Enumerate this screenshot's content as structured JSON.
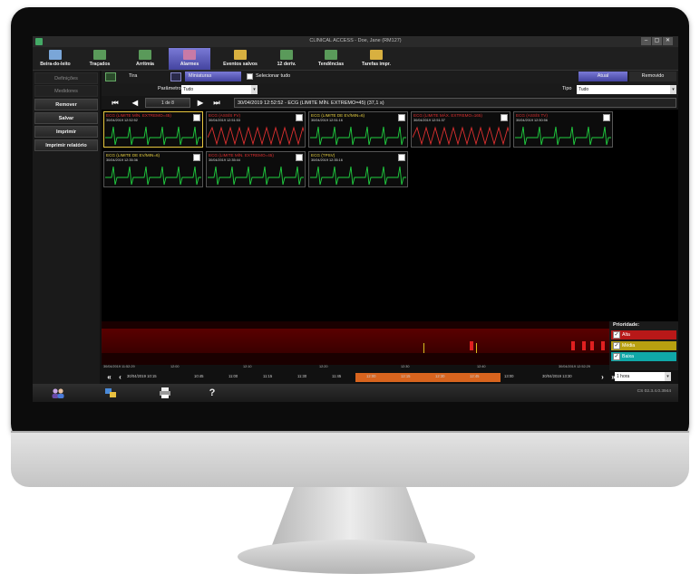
{
  "window": {
    "title": "CLINICAL ACCESS - Doe, Jane (RM127)",
    "controls": [
      "–",
      "▢",
      "✕"
    ]
  },
  "toolbar": {
    "items": [
      {
        "label": "Beira-do-leito",
        "icon": "bed-monitor-icon",
        "color": "#7aa6d8"
      },
      {
        "label": "Traçados",
        "icon": "waveform-icon",
        "color": "#5a9a5a"
      },
      {
        "label": "Arritmia",
        "icon": "arrhythmia-icon",
        "color": "#5a9a5a"
      },
      {
        "label": "Alarmes",
        "icon": "alarm-icon",
        "color": "#c87aa6"
      },
      {
        "label": "Eventos salvos",
        "icon": "folder-icon",
        "color": "#d8b040"
      },
      {
        "label": "12 deriv.",
        "icon": "leads-grid-icon",
        "color": "#5a9a5a"
      },
      {
        "label": "Tendências",
        "icon": "trends-icon",
        "color": "#5a9a5a"
      },
      {
        "label": "Tarefas impr.",
        "icon": "print-tasks-icon",
        "color": "#d8b040"
      }
    ],
    "active_index": 3
  },
  "sidebar": {
    "items": [
      {
        "label": "Definições",
        "enabled": false
      },
      {
        "label": "Medidores",
        "enabled": false
      },
      {
        "label": "Remover",
        "enabled": true
      },
      {
        "label": "Salvar",
        "enabled": true
      },
      {
        "label": "Imprimir",
        "enabled": true
      },
      {
        "label": "Imprimir relatório",
        "enabled": true
      }
    ]
  },
  "view_options": {
    "tira": "Tira",
    "miniaturas": "Miniaturas",
    "selecionar_tudo": "Selecionar tudo",
    "atual": "Atual",
    "removido": "Removido"
  },
  "filters": {
    "parametro_label": "Parâmetro",
    "parametro_value": "Tudo",
    "tipo_label": "Tipo",
    "tipo_value": "Tudo"
  },
  "pager": {
    "text": "1 de 8",
    "summary": "30/04/2019 12:52:52 - ECG (LIMITE MÍN. EXTREMO=45) (37,1 s)"
  },
  "thumbnails": [
    {
      "title": "ECG (LIMITE MÍN. EXTREMO=45)",
      "date": "30/04/2019 12:52:52",
      "color": "#e03030",
      "selected": true,
      "trace": "#20d040"
    },
    {
      "title": "ECG (ASSÍS FV)",
      "date": "30/04/2019 12:51:53",
      "color": "#e03030",
      "selected": false,
      "trace": "#e03030"
    },
    {
      "title": "ECG (LIMITE DE EV/MIN=6)",
      "date": "30/04/2019 12:51:16",
      "color": "#e8d040",
      "selected": false,
      "trace": "#20d040"
    },
    {
      "title": "ECG (LIMITE MÁX. EXTREMO=165)",
      "date": "30/04/2019 12:51:37",
      "color": "#e03030",
      "selected": false,
      "trace": "#e03030"
    },
    {
      "title": "ECG (ASSÍS TV)",
      "date": "30/04/2019 12:50:56",
      "color": "#e03030",
      "selected": false,
      "trace": "#20d040"
    },
    {
      "title": "ECG (LIMITE DE EV/MIN=6)",
      "date": "30/04/2019 12:35:36",
      "color": "#e8d040",
      "selected": false,
      "trace": "#20d040"
    },
    {
      "title": "ECG (LIMITE MÍN. EXTREMO=45)",
      "date": "30/04/2019 12:35:44",
      "color": "#e03030",
      "selected": false,
      "trace": "#20d040"
    },
    {
      "title": "ECG (TPSV)",
      "date": "30/04/2019 12:35:16",
      "color": "#e8d040",
      "selected": false,
      "trace": "#20d040"
    }
  ],
  "timeline": {
    "top_labels": [
      "30/04/2019 11:52:29",
      "12:00",
      "12:10",
      "12:20",
      "12:30",
      "12:40",
      "30/04/2019 12:52:29"
    ],
    "start_label": "30/04/2019 10:15",
    "ticks": [
      "10:45",
      "11:00",
      "11:15",
      "11:30",
      "11:45",
      "12:00",
      "12:15",
      "12:30",
      "12:45",
      "13:00"
    ],
    "end_label": "30/04/2019 13:30",
    "range_value": "1 hora",
    "events": [
      {
        "minute": 43.5,
        "level": "high"
      },
      {
        "minute": 44.2,
        "level": "medium"
      },
      {
        "minute": 55.5,
        "level": "high"
      },
      {
        "minute": 56.8,
        "level": "high"
      },
      {
        "minute": 57.8,
        "level": "high"
      },
      {
        "minute": 59.0,
        "level": "high"
      },
      {
        "minute": 38.0,
        "level": "medium"
      }
    ]
  },
  "priority": {
    "title": "Prioridade:",
    "items": [
      {
        "label": "Alta",
        "color": "#b81818"
      },
      {
        "label": "Média",
        "color": "#b8a010"
      },
      {
        "label": "Baixa",
        "color": "#10a8a8"
      }
    ]
  },
  "bottombar": {
    "buttons": [
      {
        "icon": "users-icon"
      },
      {
        "icon": "monitor-setup-icon"
      },
      {
        "icon": "printer-icon"
      },
      {
        "icon": "help-icon",
        "label": "?"
      }
    ],
    "version": "CS 02.3.4.0.3944"
  }
}
